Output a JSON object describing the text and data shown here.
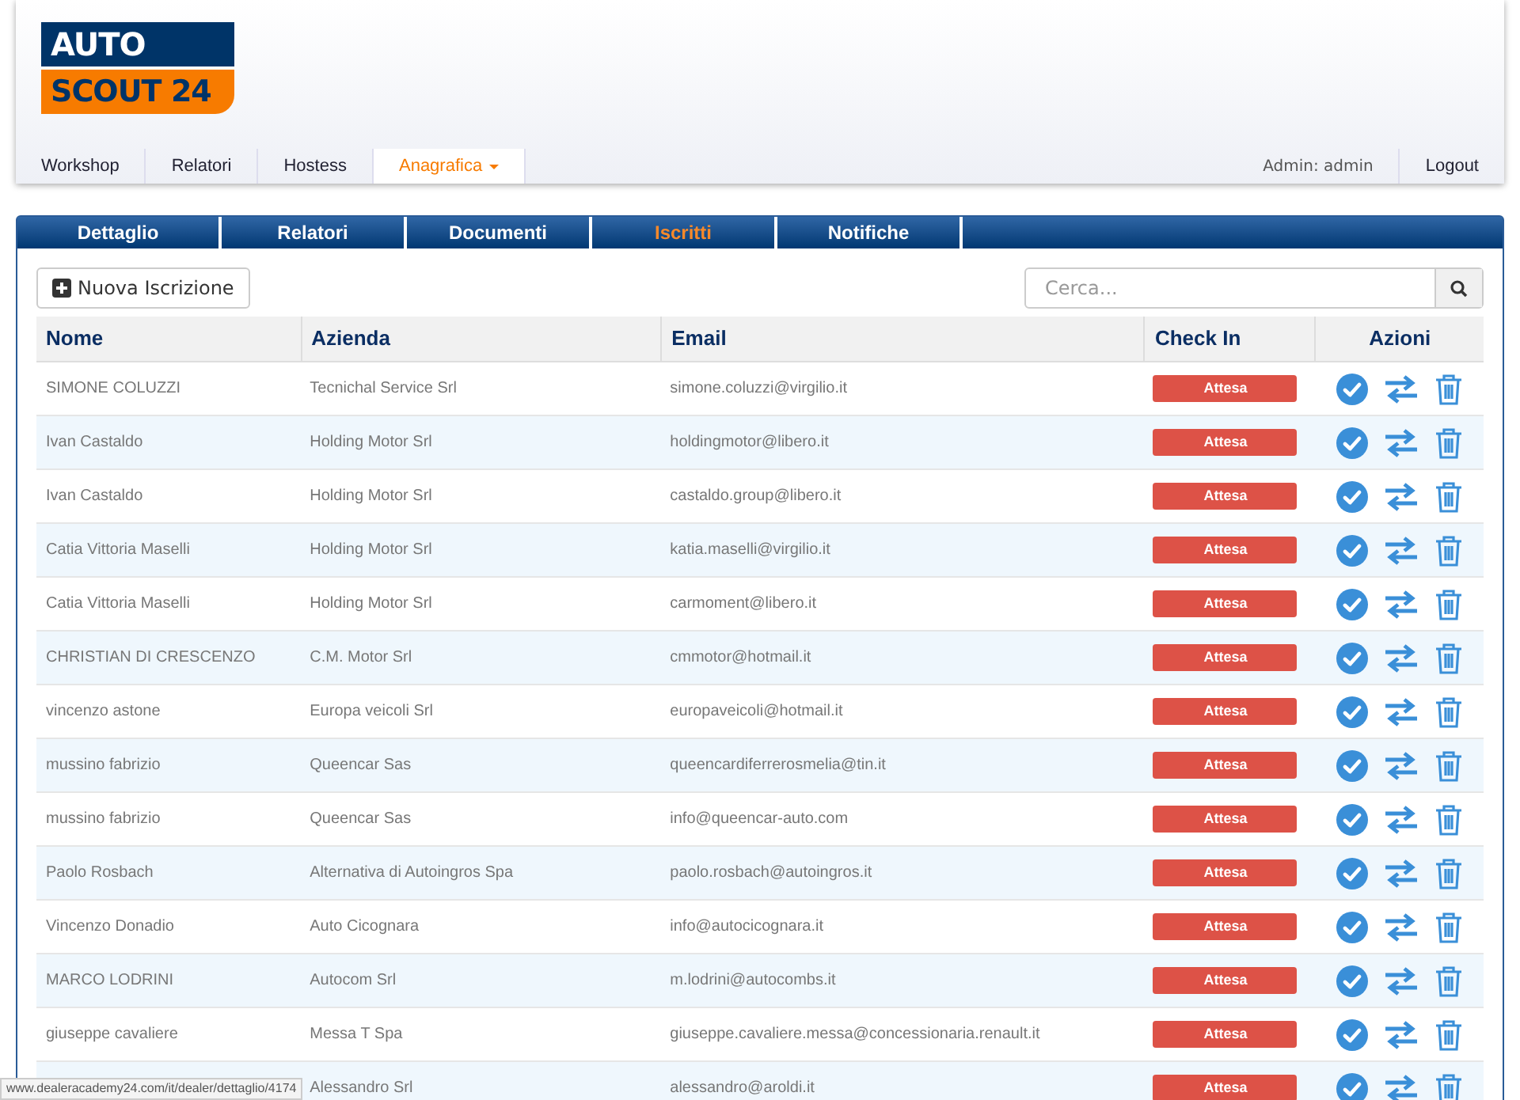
{
  "logo": {
    "line_1": "AUTO",
    "line_2": "SCOUT",
    "line_2_number": "24"
  },
  "nav": {
    "items": [
      {
        "label": "Workshop",
        "selected": false,
        "dropdown": false
      },
      {
        "label": "Relatori",
        "selected": false,
        "dropdown": false
      },
      {
        "label": "Hostess",
        "selected": false,
        "dropdown": false
      },
      {
        "label": "Anagrafica",
        "selected": true,
        "dropdown": true
      }
    ],
    "user": "Admin: admin",
    "logout": "Logout"
  },
  "tabs": [
    {
      "label": "Dettaglio",
      "selected": false
    },
    {
      "label": "Relatori",
      "selected": false
    },
    {
      "label": "Documenti",
      "selected": false
    },
    {
      "label": "Iscritti",
      "selected": true
    },
    {
      "label": "Notifiche",
      "selected": false
    }
  ],
  "new_button": "Nuova Iscrizione",
  "search": {
    "placeholder": "Cerca..."
  },
  "table": {
    "columns": [
      "Nome",
      "Azienda",
      "Email",
      "Check In",
      "Azioni"
    ],
    "rows": [
      {
        "nome": "SIMONE COLUZZI",
        "azienda": "Tecnichal Service Srl",
        "email": "simone.coluzzi@virgilio.it",
        "check_in": "Attesa"
      },
      {
        "nome": "Ivan Castaldo",
        "azienda": "Holding Motor Srl",
        "email": "holdingmotor@libero.it",
        "check_in": "Attesa"
      },
      {
        "nome": "Ivan Castaldo",
        "azienda": "Holding Motor Srl",
        "email": "castaldo.group@libero.it",
        "check_in": "Attesa"
      },
      {
        "nome": "Catia Vittoria Maselli",
        "azienda": "Holding Motor Srl",
        "email": "katia.maselli@virgilio.it",
        "check_in": "Attesa"
      },
      {
        "nome": "Catia Vittoria Maselli",
        "azienda": "Holding Motor Srl",
        "email": "carmoment@libero.it",
        "check_in": "Attesa"
      },
      {
        "nome": "CHRISTIAN DI CRESCENZO",
        "azienda": "C.M. Motor Srl",
        "email": "cmmotor@hotmail.it",
        "check_in": "Attesa"
      },
      {
        "nome": "vincenzo astone",
        "azienda": "Europa veicoli Srl",
        "email": "europaveicoli@hotmail.it",
        "check_in": "Attesa"
      },
      {
        "nome": "mussino fabrizio",
        "azienda": "Queencar Sas",
        "email": "queencardiferrerosmelia@tin.it",
        "check_in": "Attesa"
      },
      {
        "nome": "mussino fabrizio",
        "azienda": "Queencar Sas",
        "email": "info@queencar-auto.com",
        "check_in": "Attesa"
      },
      {
        "nome": "Paolo Rosbach",
        "azienda": "Alternativa di Autoingros Spa",
        "email": "paolo.rosbach@autoingros.it",
        "check_in": "Attesa"
      },
      {
        "nome": "Vincenzo Donadio",
        "azienda": "Auto Cicognara",
        "email": "info@autocicognara.it",
        "check_in": "Attesa"
      },
      {
        "nome": "MARCO LODRINI",
        "azienda": "Autocom Srl",
        "email": "m.lodrini@autocombs.it",
        "check_in": "Attesa"
      },
      {
        "nome": "giuseppe cavaliere",
        "azienda": "Messa T Spa",
        "email": "giuseppe.cavaliere.messa@concessionaria.renault.it",
        "check_in": "Attesa"
      },
      {
        "azienda": "Alessandro Srl",
        "email": "alessandro@aroldi.it",
        "check_in": "Attesa"
      }
    ]
  },
  "status_url": "www.dealeracademy24.com/it/dealer/dettaglio/4174"
}
